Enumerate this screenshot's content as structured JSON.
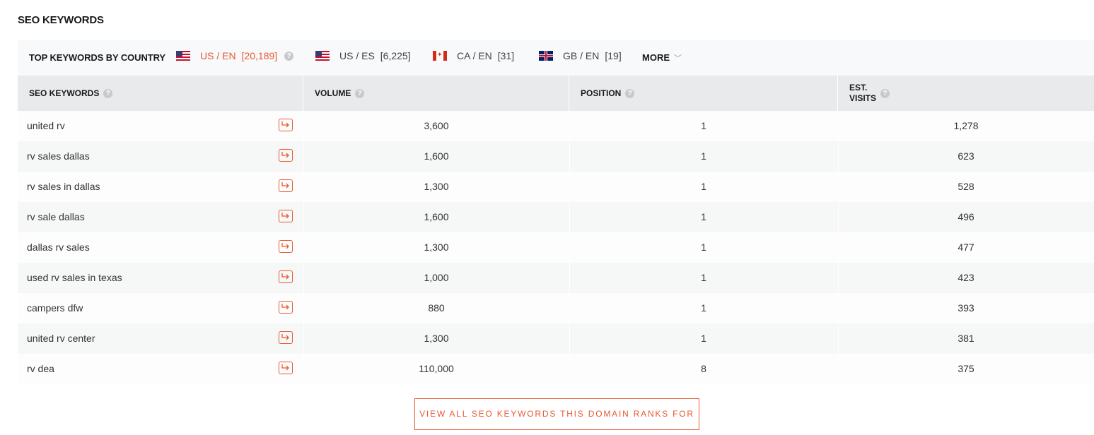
{
  "section_title": "SEO KEYWORDS",
  "country_bar": {
    "label": "TOP KEYWORDS BY COUNTRY",
    "tabs": [
      {
        "flag": "us-flag-icon",
        "code": "US / EN",
        "count": "[20,189]",
        "active": true
      },
      {
        "flag": "us-flag-icon",
        "code": "US / ES",
        "count": "[6,225]",
        "active": false
      },
      {
        "flag": "ca-flag-icon",
        "code": "CA / EN",
        "count": "[31]",
        "active": false
      },
      {
        "flag": "gb-flag-icon",
        "code": "GB / EN",
        "count": "[19]",
        "active": false
      }
    ],
    "more_label": "MORE",
    "accent_color": "#e85a33"
  },
  "table": {
    "headers": {
      "keyword": "SEO KEYWORDS",
      "volume": "VOLUME",
      "position": "POSITION",
      "visits_line1": "EST.",
      "visits_line2": "VISITS"
    },
    "rows": [
      {
        "keyword": "united rv",
        "volume": "3,600",
        "position": "1",
        "visits": "1,278"
      },
      {
        "keyword": "rv sales dallas",
        "volume": "1,600",
        "position": "1",
        "visits": "623"
      },
      {
        "keyword": "rv sales in dallas",
        "volume": "1,300",
        "position": "1",
        "visits": "528"
      },
      {
        "keyword": "rv sale dallas",
        "volume": "1,600",
        "position": "1",
        "visits": "496"
      },
      {
        "keyword": "dallas rv sales",
        "volume": "1,300",
        "position": "1",
        "visits": "477"
      },
      {
        "keyword": "used rv sales in texas",
        "volume": "1,000",
        "position": "1",
        "visits": "423"
      },
      {
        "keyword": "campers dfw",
        "volume": "880",
        "position": "1",
        "visits": "393"
      },
      {
        "keyword": "united rv center",
        "volume": "1,300",
        "position": "1",
        "visits": "381"
      },
      {
        "keyword": "rv dea",
        "volume": "110,000",
        "position": "8",
        "visits": "375"
      }
    ]
  },
  "view_all_label": "VIEW ALL SEO KEYWORDS THIS DOMAIN RANKS FOR"
}
